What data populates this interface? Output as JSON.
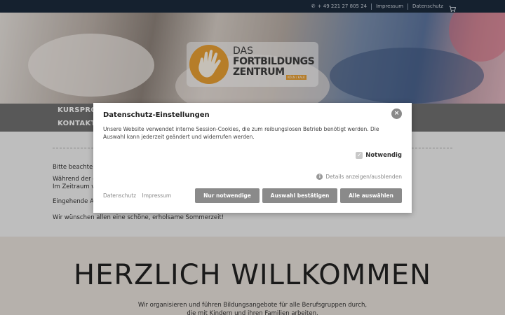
{
  "topbar": {
    "phone": "+ 49 221 27 805 24",
    "impressum": "Impressum",
    "datenschutz": "Datenschutz",
    "cart_icon": "cart-icon",
    "phone_icon": "phone-icon"
  },
  "logo": {
    "line1": "DAS",
    "line2": "FORTBILDUNGS",
    "line3": "ZENTRUM",
    "badge": "KÖLN / KALK"
  },
  "nav": {
    "item1": "KURSPRO",
    "item2": "KONTAKT"
  },
  "content": {
    "line1": "Bitte beachter",
    "line2": "Während der g",
    "line3": "Im Zeitraum v",
    "line4": "Eingehende An",
    "line5": "Wir wünschen allen eine schöne, erholsame Sommerzeit!"
  },
  "welcome": {
    "title": "HERZLICH WILLKOMMEN",
    "text1": "Wir organisieren und führen Bildungsangebote für alle Berufsgruppen durch,",
    "text2": "die mit Kindern und ihren Familien arbeiten."
  },
  "modal": {
    "title": "Datenschutz-Einstellungen",
    "close": "×",
    "text": "Unsere Website verwendet interne Session-Cookies, die zum reibungslosen Betrieb benötigt werden. Die Auswahl kann jederzeit geändert und widerrufen werden.",
    "checkbox_label": "Notwendig",
    "details": "Details anzeigen/ausblenden",
    "link_datenschutz": "Datenschutz",
    "link_impressum": "Impressum",
    "btn_necessary": "Nur notwendige",
    "btn_confirm": "Auswahl bestätigen",
    "btn_all": "Alle auswählen"
  },
  "colors": {
    "topbar": "#1c2b3d",
    "logo_orange": "#e9a034",
    "button_gray": "#8a8a8a"
  }
}
